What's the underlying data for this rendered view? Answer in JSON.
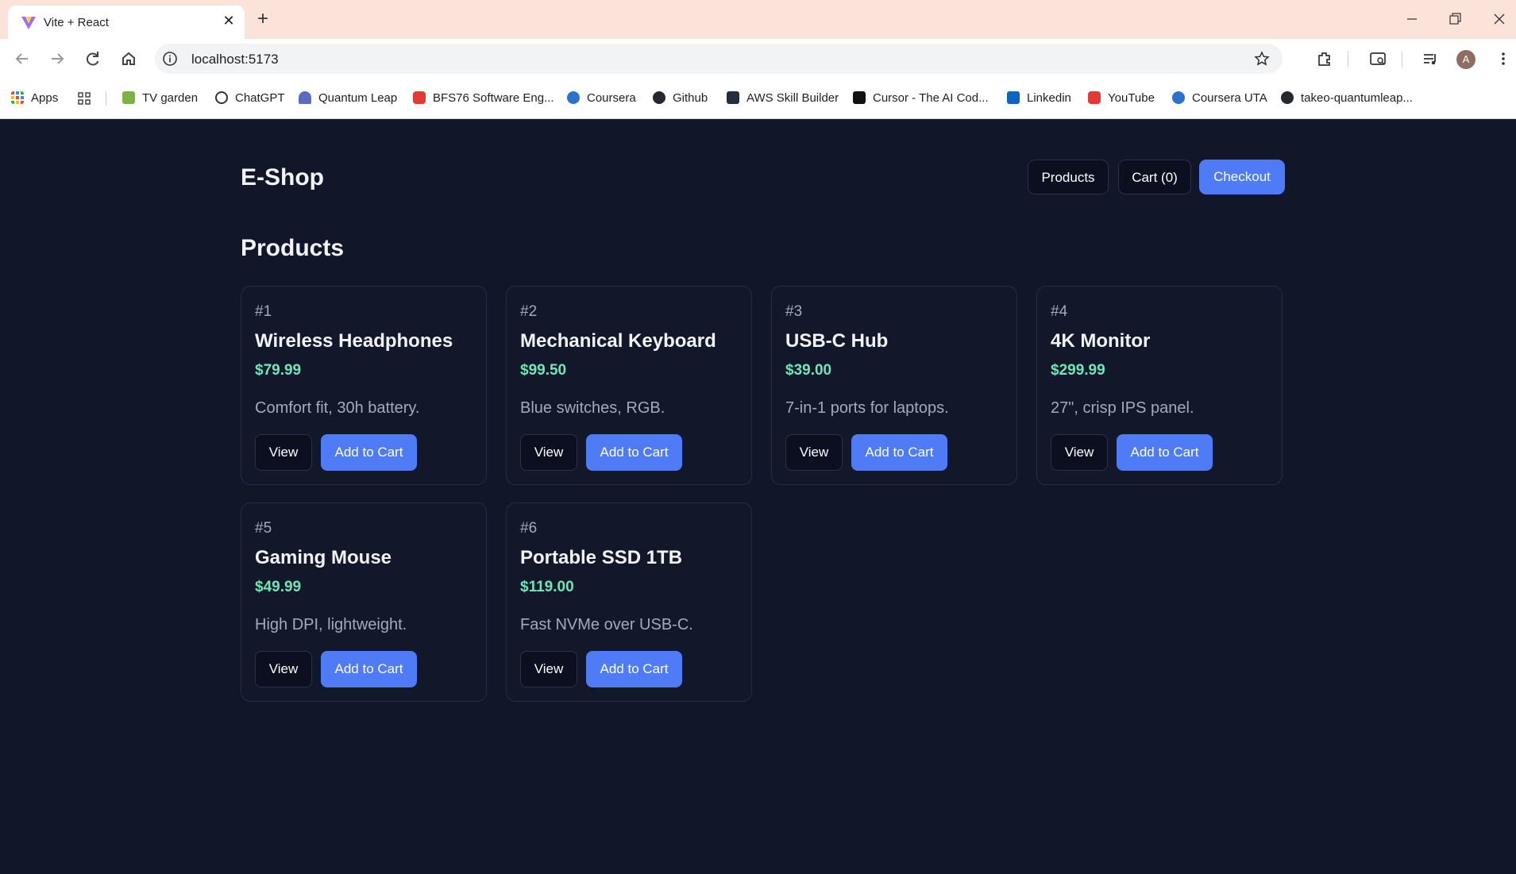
{
  "browser": {
    "tab_title": "Vite + React",
    "url": "localhost:5173",
    "profile_initial": "A",
    "bookmarks": [
      {
        "label": "Apps",
        "icon": "apps-grid-icon"
      },
      {
        "label": "TV garden",
        "icon": "tv-garden-icon"
      },
      {
        "label": "ChatGPT",
        "icon": "chatgpt-icon"
      },
      {
        "label": "Quantum Leap",
        "icon": "quantum-leap-icon"
      },
      {
        "label": "BFS76 Software Eng...",
        "icon": "youtube-icon"
      },
      {
        "label": "Coursera",
        "icon": "coursera-icon"
      },
      {
        "label": "Github",
        "icon": "github-icon"
      },
      {
        "label": "AWS Skill Builder",
        "icon": "aws-icon"
      },
      {
        "label": "Cursor - The AI Cod...",
        "icon": "cursor-icon"
      },
      {
        "label": "Linkedin",
        "icon": "linkedin-icon"
      },
      {
        "label": "YouTube",
        "icon": "youtube-icon"
      },
      {
        "label": "Coursera UTA",
        "icon": "coursera-icon"
      },
      {
        "label": "takeo-quantumleap...",
        "icon": "github-icon"
      }
    ]
  },
  "app": {
    "brand": "E-Shop",
    "nav": {
      "products": "Products",
      "cart": "Cart (0)",
      "checkout": "Checkout"
    },
    "section_title": "Products",
    "view_label": "View",
    "add_label": "Add to Cart",
    "products": [
      {
        "id": "#1",
        "name": "Wireless Headphones",
        "price": "$79.99",
        "desc": "Comfort fit, 30h battery."
      },
      {
        "id": "#2",
        "name": "Mechanical Keyboard",
        "price": "$99.50",
        "desc": "Blue switches, RGB."
      },
      {
        "id": "#3",
        "name": "USB-C Hub",
        "price": "$39.00",
        "desc": "7-in-1 ports for laptops."
      },
      {
        "id": "#4",
        "name": "4K Monitor",
        "price": "$299.99",
        "desc": "27\", crisp IPS panel."
      },
      {
        "id": "#5",
        "name": "Gaming Mouse",
        "price": "$49.99",
        "desc": "High DPI, lightweight."
      },
      {
        "id": "#6",
        "name": "Portable SSD 1TB",
        "price": "$119.00",
        "desc": "Fast NVMe over USB-C."
      }
    ]
  },
  "colors": {
    "page_bg": "#111629",
    "card_bg": "#121829",
    "accent": "#4f7cf6",
    "price": "#6ee7b7",
    "tabstrip": "#fbe3d9"
  }
}
